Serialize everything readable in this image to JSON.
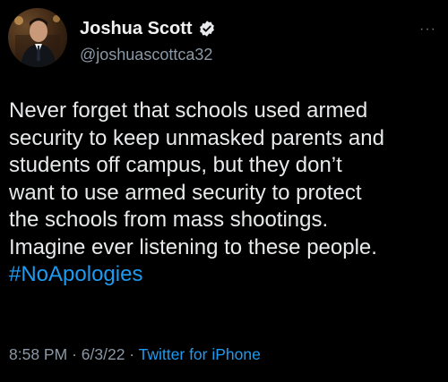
{
  "author": {
    "name": "Joshua Scott",
    "handle": "@joshuascottca32",
    "verified_icon": "verified-badge-icon",
    "avatar_icon": "avatar"
  },
  "more_icon": "more-options-icon",
  "more_glyph": "···",
  "tweet": {
    "lines": [
      "Never forget that schools used armed",
      "security to keep unmasked parents and",
      "students off campus, but they don’t",
      "want to use armed security to protect",
      "the schools from mass shootings.",
      "Imagine ever listening to these people."
    ],
    "hashtag": "#NoApologies"
  },
  "meta": {
    "time": "8:58 PM",
    "separator": "·",
    "date": "6/3/22",
    "client": "Twitter for iPhone"
  },
  "colors": {
    "background": "#000000",
    "text": "#e7e9ea",
    "muted": "#8b98a5",
    "accent": "#1d9bf0"
  }
}
